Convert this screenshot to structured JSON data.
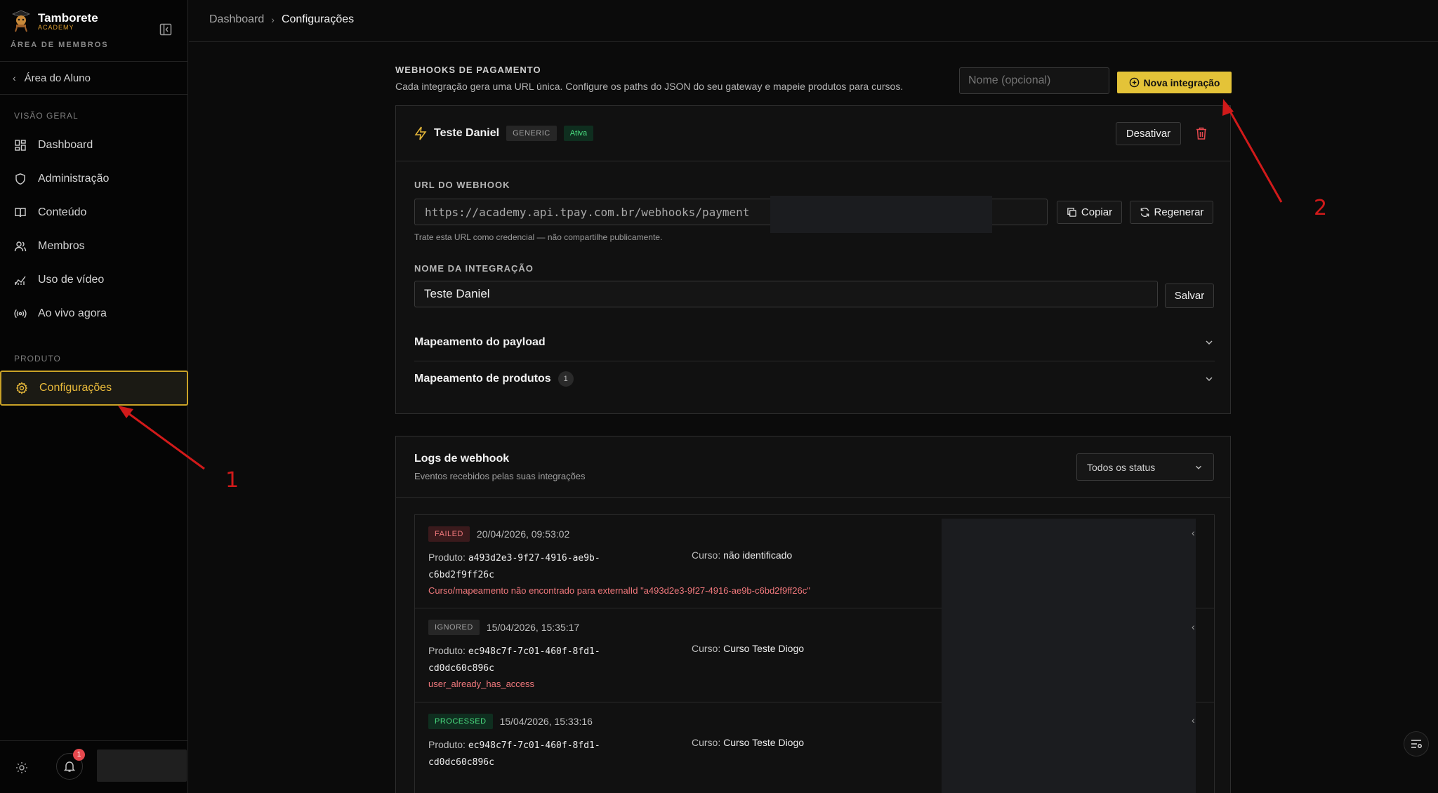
{
  "brand": {
    "name": "Tamborete",
    "sub": "ACADEMY",
    "area": "ÁREA DE MEMBROS"
  },
  "sidebar": {
    "back_label": "Área do Aluno",
    "section_overview": "VISÃO GERAL",
    "items": [
      {
        "label": "Dashboard",
        "icon": "dashboard-icon"
      },
      {
        "label": "Administração",
        "icon": "shield-icon"
      },
      {
        "label": "Conteúdo",
        "icon": "book-icon"
      },
      {
        "label": "Membros",
        "icon": "users-icon"
      },
      {
        "label": "Uso de vídeo",
        "icon": "chart-icon"
      },
      {
        "label": "Ao vivo agora",
        "icon": "broadcast-icon"
      }
    ],
    "section_product": "PRODUTO",
    "active_item": {
      "label": "Configurações",
      "icon": "gear-icon"
    },
    "notification_count": "1"
  },
  "breadcrumb": {
    "parent": "Dashboard",
    "current": "Configurações"
  },
  "webhooks": {
    "title": "WEBHOOKS DE PAGAMENTO",
    "description": "Cada integração gera uma URL única. Configure os paths do JSON do seu gateway e mapeie produtos para cursos.",
    "name_placeholder": "Nome (opcional)",
    "new_button": "Nova integração"
  },
  "integration": {
    "name": "Teste Daniel",
    "type_tag": "GENERIC",
    "status_tag": "Ativa",
    "deactivate_label": "Desativar",
    "url_label": "URL DO WEBHOOK",
    "url_value": "https://academy.api.tpay.com.br/webhooks/payment",
    "copy_label": "Copiar",
    "regenerate_label": "Regenerar",
    "url_hint": "Trate esta URL como credencial — não compartilhe publicamente.",
    "name_label": "NOME DA INTEGRAÇÃO",
    "name_value": "Teste Daniel",
    "save_label": "Salvar",
    "payload_mapping": "Mapeamento do payload",
    "product_mapping": "Mapeamento de produtos",
    "product_mapping_count": "1"
  },
  "logs": {
    "title": "Logs de webhook",
    "subtitle": "Eventos recebidos pelas suas integrações",
    "status_filter": "Todos os status",
    "product_label": "Produto:",
    "course_label": "Curso:",
    "entries": [
      {
        "status": "FAILED",
        "date": "20/04/2026, 09:53:02",
        "product_line1": "a493d2e3-9f27-4916-ae9b-",
        "product_line2": "c6bd2f9ff26c",
        "course": "não identificado",
        "message": "Curso/mapeamento não encontrado para externalId \"a493d2e3-9f27-4916-ae9b-c6bd2f9ff26c\""
      },
      {
        "status": "IGNORED",
        "date": "15/04/2026, 15:35:17",
        "product_line1": "ec948c7f-7c01-460f-8fd1-",
        "product_line2": "cd0dc60c896c",
        "course": "Curso Teste Diogo",
        "message": "user_already_has_access"
      },
      {
        "status": "PROCESSED",
        "date": "15/04/2026, 15:33:16",
        "product_line1": "ec948c7f-7c01-460f-8fd1-",
        "product_line2": "cd0dc60c896c",
        "course": "Curso Teste Diogo",
        "message": ""
      }
    ]
  },
  "annotations": {
    "one": "1",
    "two": "2"
  },
  "colors": {
    "accent": "#e4c338",
    "active_border": "#c9a227",
    "annotation": "#d11a1a"
  }
}
